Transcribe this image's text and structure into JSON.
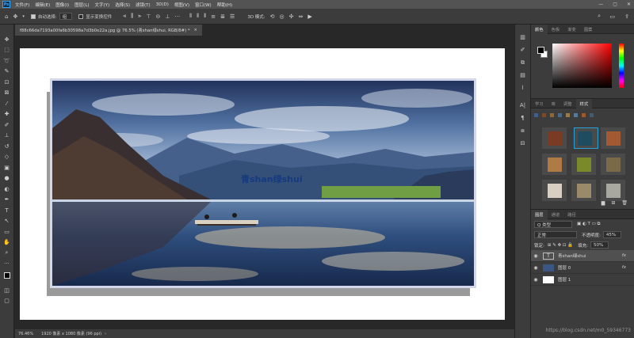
{
  "menubar": {
    "app_icon": "Ps",
    "items": [
      "文件(F)",
      "编辑(E)",
      "图像(I)",
      "图层(L)",
      "文字(Y)",
      "选择(S)",
      "滤镜(T)",
      "3D(D)",
      "视图(V)",
      "窗口(W)",
      "帮助(H)"
    ],
    "window_controls": [
      "—",
      "▢",
      "✕"
    ]
  },
  "options": {
    "auto_select_label": "自动选择:",
    "auto_select_value": "组",
    "show_transform_label": "显示变换控件",
    "mode_3d_label": "3D 模式:"
  },
  "document": {
    "tab_title": "f88c66da7193a00fa6b30598a7d3b0e22a.jpg @ 76.5% (青shan绿shui, RGB/8#) *",
    "watermark_text": "青shan绿shui"
  },
  "status": {
    "zoom": "76.46%",
    "doc_info": "1920 像素 x 1080 像素 (96 ppi)"
  },
  "color_panel": {
    "tabs": [
      "颜色",
      "色板",
      "渐变",
      "图案"
    ],
    "fg_color": "#000000",
    "bg_color": "#ffffff"
  },
  "styles_panel": {
    "tabs": [
      "学习",
      "库",
      "调整",
      "样式"
    ],
    "mini_swatches": [
      "#3f5f8a",
      "#7a4a2a",
      "#8a6a3a",
      "#4a6a8a",
      "#9a7a4a",
      "#5a7a9a",
      "#a05a2a",
      "#4a5a6a"
    ],
    "swatches": [
      "#7a3b22",
      "#1f4c5e",
      "#a35a32",
      "#b07a45",
      "#7a8a2a",
      "#7a6a48",
      "#d8cfc2",
      "#9a8a6a",
      "#a8a8a0"
    ]
  },
  "layers_panel": {
    "tabs": [
      "图层",
      "通道",
      "路径"
    ],
    "filter_kind": "Q 类型",
    "blend_mode": "正常",
    "opacity_label": "不透明度:",
    "opacity_value": "45%",
    "lock_label": "锁定:",
    "fill_label": "填充:",
    "fill_value": "50%",
    "layers": [
      {
        "name": "青shan绿shui",
        "thumb": "T",
        "fx": "fx",
        "active": true
      },
      {
        "name": "图层 0",
        "thumb": "",
        "fx": "fx",
        "active": false
      },
      {
        "name": "图层 1",
        "thumb": "",
        "fx": "",
        "active": false
      }
    ]
  },
  "footer_watermark": "https://blog.csdn.net/m0_59346773"
}
